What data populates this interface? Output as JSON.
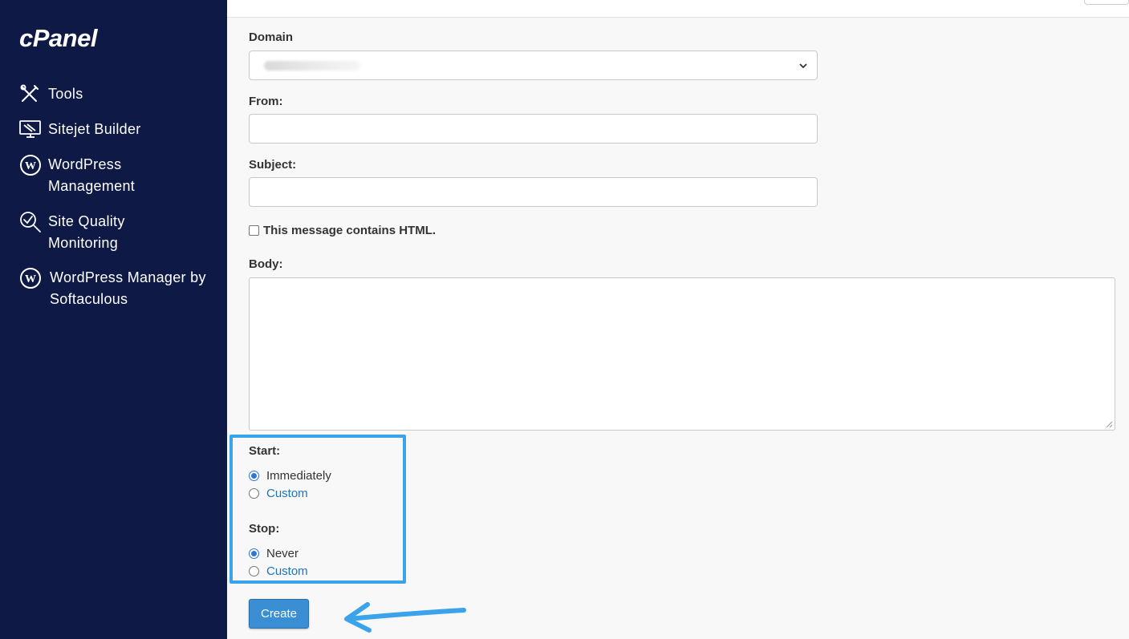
{
  "sidebar": {
    "logo": "cPanel",
    "items": [
      {
        "label": "Tools",
        "icon": "tools-icon"
      },
      {
        "label": "Sitejet Builder",
        "icon": "monitor-icon"
      },
      {
        "label": "WordPress Management",
        "icon": "wordpress-icon"
      },
      {
        "label": "Site Quality Monitoring",
        "icon": "magnify-check-icon"
      },
      {
        "label": "WordPress Manager by Softaculous",
        "icon": "wordpress-icon"
      }
    ]
  },
  "form": {
    "domain_label": "Domain",
    "domain_value": "",
    "from_label": "From:",
    "from_value": "",
    "subject_label": "Subject:",
    "subject_value": "",
    "html_checkbox_label": "This message contains HTML.",
    "html_checked": false,
    "body_label": "Body:",
    "body_value": "",
    "start_label": "Start:",
    "start_options": [
      "Immediately",
      "Custom"
    ],
    "start_selected": "Immediately",
    "stop_label": "Stop:",
    "stop_options": [
      "Never",
      "Custom"
    ],
    "stop_selected": "Never",
    "create_label": "Create"
  },
  "colors": {
    "sidebar_bg": "#0e1a45",
    "highlight": "#3aa3ec",
    "button": "#3a8fd4",
    "link": "#1f74b8"
  }
}
